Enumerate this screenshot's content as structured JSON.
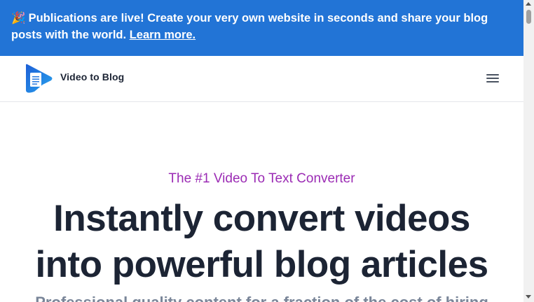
{
  "banner": {
    "icon": "party-popper-icon",
    "icon_glyph": "🎉",
    "text": "Publications are live! Create your very own website in seconds and share your blog posts with the world.",
    "link_label": "Learn more.",
    "background": "#2274d6"
  },
  "header": {
    "brand_name": "Video to Blog",
    "menu_icon": "hamburger-menu-icon"
  },
  "hero": {
    "eyebrow": "The #1 Video To Text Converter",
    "headline_line1": "Instantly convert videos",
    "headline_line2": "into powerful blog articles",
    "subhead": "Professional quality content for a fraction of the cost of hiring",
    "eyebrow_color": "#9b2bb4",
    "headline_color": "#1c2434"
  }
}
